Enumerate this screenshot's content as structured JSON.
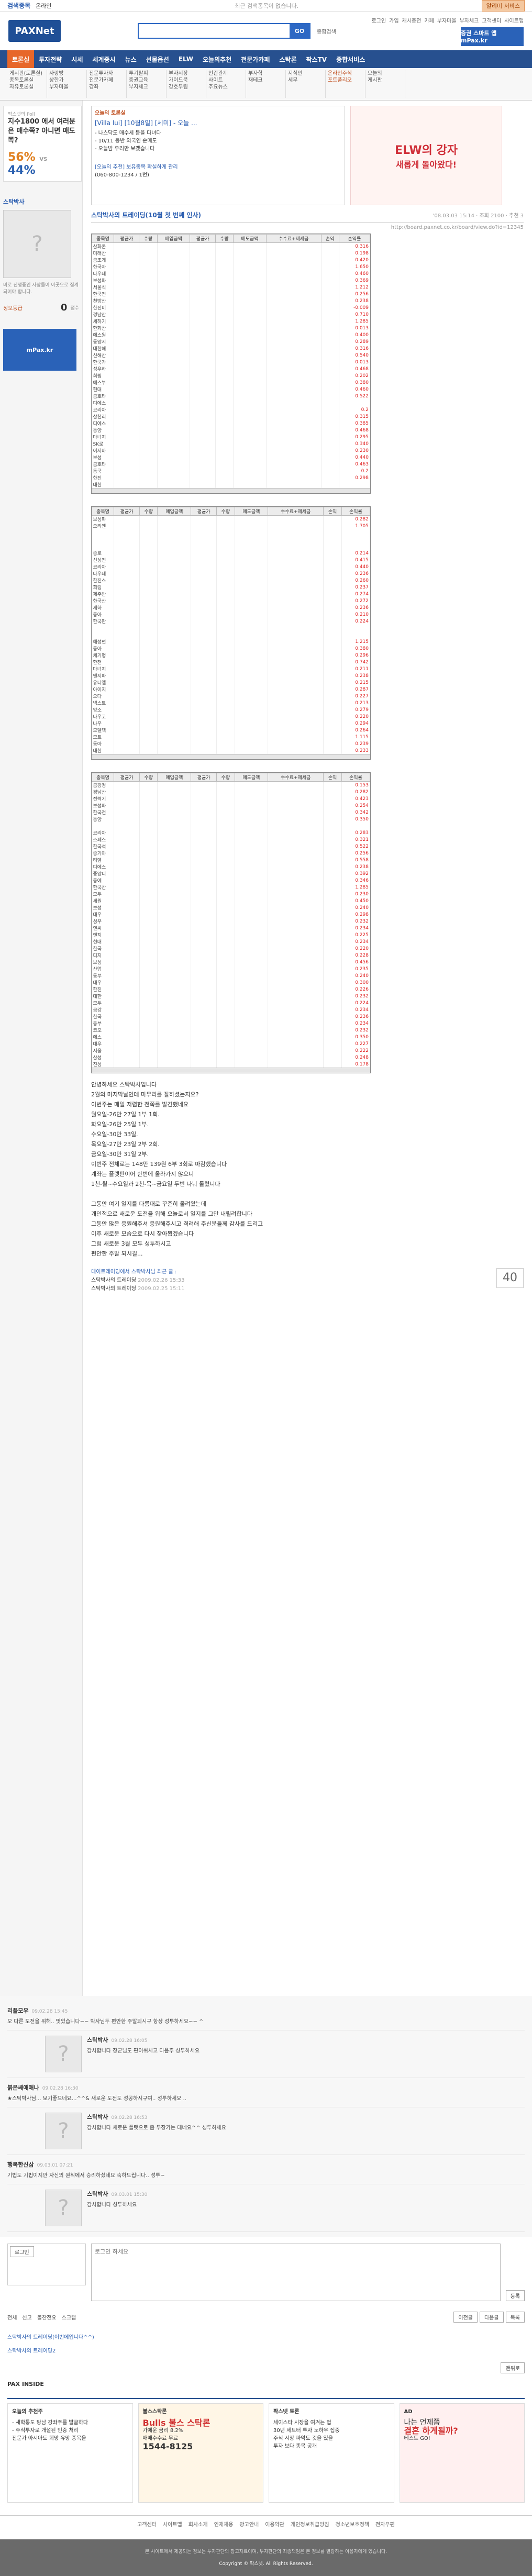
{
  "top": {
    "title": "검색종목",
    "sub": "온라인",
    "center": "최근 검색종목이 없습니다.",
    "help": "알리미 서비스"
  },
  "header": {
    "logo": "PAXNet",
    "search_placeholder": "",
    "search_btn": "GO",
    "extra": "종합검색",
    "ad": "증권 스마트 앱 mPax.kr",
    "util": [
      "로그인",
      "가입",
      "캐시충전",
      "카페",
      "부자마을",
      "부자체크",
      "고객센터",
      "사이트맵"
    ]
  },
  "nav": [
    "토론실",
    "투자전략",
    "시세",
    "세계증시",
    "뉴스",
    "선물옵션",
    "ELW",
    "오늘의추천",
    "전문가카페",
    "스탁론",
    "팍스TV",
    "종합서비스"
  ],
  "submenu": [
    [
      "게시판(토론실)",
      "종목토론실",
      "자유토론실"
    ],
    [
      "사랑방",
      "상한가",
      "부자마을"
    ],
    [
      "전문투자자",
      "전문가카페",
      "강좌"
    ],
    [
      "투기탈피",
      "증권교육",
      "부자체크"
    ],
    [
      "부자시장",
      "가이드북",
      "강호무림"
    ],
    [
      "인간관계",
      "사이트",
      "주요뉴스"
    ],
    [
      "부자학",
      "재테크"
    ],
    [
      "지식인",
      "세무"
    ],
    [
      "온라인주식",
      "포트폴리오"
    ],
    [
      "오늘의",
      "게시판"
    ]
  ],
  "sidebar": {
    "poll_label": "팍스넷의 Poll",
    "poll_q": "지수1800 에서 여러분은 매수쪽? 아니면 매도쪽?",
    "pct_a": "56%",
    "vs": "VS",
    "pct_b": "44%",
    "nick": "스탁박사",
    "intro": "바로 진행중인 사항들이 이곳으로 집계되어야 합니다.",
    "level_label": "정보등급",
    "level": "0",
    "level_unit": "점수",
    "mpax": "mPax.kr"
  },
  "hottopic": {
    "label": "오늘의 토론실",
    "title": "[Villa lui] [10월8일] [세미] - 오늘 ...",
    "lines": [
      "- 나스닥도 매수세 등을 다녀다",
      "- 10/11 동반 외국인 순매도",
      "- 오늘밤 우리만 보겠습니다"
    ],
    "sub": "[오늘의 추천] 보유종목 확실하게 관리",
    "tel": "(060-800-1234 / 1번)"
  },
  "ad": {
    "main": "ELW의 강자",
    "sub": "새롭게 돌아왔다!"
  },
  "post": {
    "title": "스탁박사의 트레이딩(10월 첫 번째 인사)",
    "meta": "'08.03.03 15:14 · 조회 2100 · 추천 3",
    "url": "http://board.paxnet.co.kr/board/view.do?id=12345"
  },
  "sheet_cols": [
    "종목명",
    "평균가",
    "수량",
    "매입금액",
    "평균가",
    "수량",
    "매도금액",
    "수수료+제세금",
    "손익",
    "손익률"
  ],
  "sheets": [
    {
      "names": [
        "삼화콘",
        "미래산",
        "금조개",
        "한국자",
        "다우데",
        "보성파",
        "서울식",
        "한국전",
        "천방산",
        "한진미",
        "경남산",
        "세하기",
        "한화산",
        "에스원",
        "동양시",
        "대한해",
        "신해산",
        "한국가",
        "성우하",
        "희림",
        "에스부",
        "현대",
        "금호타",
        "디에스",
        "코리아",
        "삼천리",
        "디에스",
        "동양",
        "마녀지",
        "SK로",
        "이지바",
        "보성",
        "금호타",
        "동국",
        "한진",
        "대한"
      ],
      "vals": [
        "0.316",
        "0.198",
        "0.420",
        "1.650",
        "0.460",
        "0.369",
        "1.212",
        "0.256",
        "0.238",
        "-0.009",
        "0.710",
        "1.285",
        "0.013",
        "0.400",
        "0.289",
        "0.316",
        "0.540",
        "0.013",
        "0.468",
        "0.202",
        "0.380",
        "0.460",
        "0.522",
        "",
        "0.2",
        "0.315",
        "0.385",
        "0.468",
        "0.295",
        "0.340",
        "0.230",
        "0.440",
        "0.463",
        "0.2",
        "0.298",
        ""
      ]
    },
    {
      "names": [
        "보성파",
        "오리엔",
        "",
        "",
        "",
        "종로",
        "신성전",
        "코리아",
        "다우데",
        "한진스",
        "희림",
        "제주반",
        "한국산",
        "세하",
        "동아",
        "한국판",
        "",
        "",
        "해성면",
        "동아",
        "체기평",
        "한천",
        "마녀지",
        "엔지파",
        "유니엘",
        "아이지",
        "오다",
        "넥스트",
        "양소",
        "나우코",
        "나우",
        "모델텍",
        "모트",
        "동아",
        "대한"
      ],
      "vals": [
        "0.282",
        "1.705",
        "",
        "",
        "",
        "0.214",
        "0.415",
        "0.440",
        "0.236",
        "0.260",
        "0.237",
        "0.274",
        "0.272",
        "0.236",
        "0.210",
        "0.224",
        "",
        "",
        "1.215",
        "0.380",
        "0.296",
        "0.742",
        "0.211",
        "0.238",
        "0.215",
        "0.287",
        "0.227",
        "0.213",
        "0.279",
        "0.220",
        "0.294",
        "0.264",
        "1.115",
        "0.239",
        "0.233"
      ]
    },
    {
      "names": [
        "금강정",
        "경남산",
        "전력기",
        "보성파",
        "한국전",
        "동양",
        "",
        "코리아",
        "스페스",
        "한국석",
        "중기아",
        "티엠",
        "디에스",
        "중앙디",
        "동에",
        "한국산",
        "모두",
        "세원",
        "보성",
        "대우",
        "성우",
        "엔씨",
        "엔지",
        "현대",
        "한국",
        "디지",
        "보성",
        "산업",
        "동부",
        "대우",
        "한진",
        "대한",
        "모두",
        "금강",
        "한국",
        "동부",
        "코오",
        "에스",
        "대우",
        "서울",
        "삼성",
        "진성"
      ],
      "vals": [
        "0.153",
        "0.282",
        "0.423",
        "0.254",
        "0.342",
        "0.350",
        "",
        "0.283",
        "0.321",
        "0.522",
        "0.256",
        "0.558",
        "0.238",
        "0.392",
        "0.346",
        "1.285",
        "0.230",
        "0.450",
        "0.240",
        "0.298",
        "0.232",
        "0.234",
        "0.225",
        "0.234",
        "0.220",
        "0.228",
        "0.456",
        "0.235",
        "0.240",
        "0.300",
        "0.226",
        "0.232",
        "0.224",
        "0.234",
        "0.236",
        "0.234",
        "0.232",
        "0.350",
        "0.227",
        "0.222",
        "0.248",
        "0.178"
      ]
    }
  ],
  "body": [
    "안녕하세요 스탁박사입니다",
    "2월의 마지막날인데 마무리를 잘하셨는지요?",
    "이번주는 매일 저렴한 전쭉를 발견했네요",
    "월요일-26만 27일 1부 1회.",
    "화요일-26만 25일 1부.",
    "수요일-30만 33일.",
    "목요일-27만 23일 2부 2회.",
    "금요일-30만 31일 2부.",
    "이번주 전체로는 148만 139원 6부 3회로 마감했습니다",
    "계좌는 플랫판이어 한번에 올라가지 않으니",
    "1천-월~수요일과 2천-목~금요일 두번 나눠 돌렸니다",
    "",
    "그동안 여기 일지를 다룸대로 꾸준히 올려왔는데",
    "개인적으로 새로운 도전을 위해 오늘로서 일지를 그만 내릴려합니다",
    "그동안 많은 응원해주셔 응원해주시고 격려해 주신분들께 감사를 드리고",
    "이후 새로운 모습으로 다시 찾아뵙겠습니다",
    "그럼 새로운 3월 모두 성투하시고",
    "편안한 주말 되시길..."
  ],
  "related": {
    "hd": "데이트레이딩에서 스탁박사님 최근 글 :",
    "items": [
      "스탁박사의 트레이딩",
      "스탁박사의 트레이딩"
    ],
    "dates": [
      "2009.02.26 15:33",
      "2009.02.25 15:11"
    ],
    "score": "40"
  },
  "comments": [
    {
      "who": "리플모우",
      "when": "09.02.28 15:45",
      "txt": "오 다른 도전을 위해.. 멋있습니다~~ 박사님두 편안한 주말되시구 항상 성투하세요~~ ^",
      "rep": false
    },
    {
      "who": "스탁박사",
      "when": "09.02.28 16:05",
      "txt": "감사합니다 장군님도 편이쉬시고 다음주 성투하세요",
      "rep": true
    },
    {
      "who": "붉은쌔애애나",
      "when": "09.02.28 16:30",
      "txt": "★스탁박사님... 보기좋으네요...^^& 새로운 도전도 성공하시구여.. 성투하세요 ..",
      "rep": false
    },
    {
      "who": "스탁박사",
      "when": "09.02.28 16:53",
      "txt": "감사합니다 새로운 플랫으로 좀 무장가는 데네요^^ 성투하세요",
      "rep": true
    },
    {
      "who": "행복한신삼",
      "when": "09.03.01 07:21",
      "txt": "기법도 기법이지만 자신의 원칙에서 승리하셨네요 축하드립니다.. 성투~",
      "rep": false
    },
    {
      "who": "스탁박사",
      "when": "09.03.01 15:30",
      "txt": "감사합니다 성투하세요",
      "rep": true
    }
  ],
  "write": {
    "placeholder": "로그인 하세요",
    "login": "로그인",
    "register": "등록"
  },
  "postnav": {
    "items": [
      "전체",
      "신고",
      "볼찬전요",
      "스크랩"
    ],
    "list": "목록",
    "prev": "이전글",
    "next": "다음글"
  },
  "prevnext": [
    "스탁박사의 트레이딩(이번에입니다^^)",
    "스탁박사의 트레이딩2"
  ],
  "top_btn": "맨위로",
  "pax": {
    "hd": "PAX INSIDE",
    "c1": {
      "h": "오늘의 추천주",
      "l": [
        "- 새학통도 탕남 강좌주를 발굴하다",
        "- 주식투자로 개설된 인증 처리",
        "전문가 아시아도 희망 유망 종목을"
      ]
    },
    "c2": {
      "h": "불스스탁론",
      "l": [
        "Bulls 불스 스탁론",
        "가에운 금리 8.2%",
        "매매수수료 무료",
        "1544-8125"
      ]
    },
    "c3": {
      "h": "팍스넷 토론",
      "l": [
        "세이스타 시장을 여겨는 법",
        "30년 세트터 투자 노하우 집중",
        "주식 시장 파악도 것을 있을",
        "투자 보다 종목 공개"
      ]
    },
    "c4": {
      "h": "AD",
      "l": [
        "나는 언제쯤",
        "결혼 하게될까?",
        "테스트 GO!"
      ]
    }
  },
  "footlinks": [
    "고객센터",
    "사이트맵",
    "회사소개",
    "인재채용",
    "광고안내",
    "이용약관",
    "개인정보취급방침",
    "청소년보호정책",
    "전자우편"
  ],
  "footer": [
    "본 사이트에서 제공되는 정보는 투자판단의 참고자료이며, 투자판단의 최종책임은 본 정보를 열람하는 이용자에게 있습니다.",
    "Copyright © 팍스넷. All Rights Reserved."
  ]
}
